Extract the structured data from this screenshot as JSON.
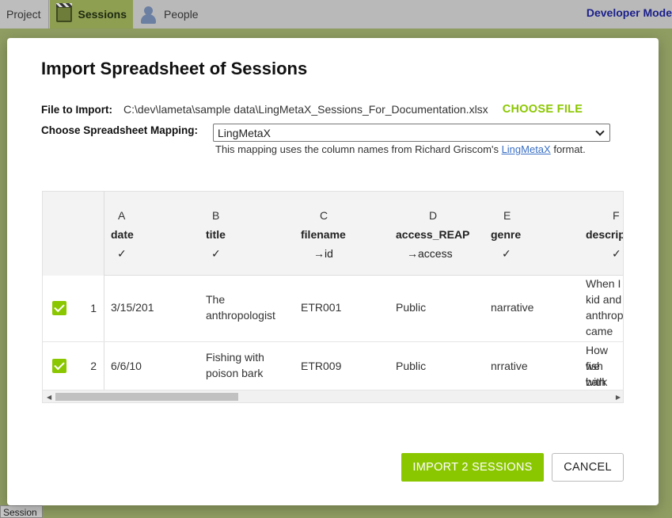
{
  "app": {
    "tabs": [
      {
        "label": "Project"
      },
      {
        "label": "Sessions"
      },
      {
        "label": "People"
      }
    ],
    "developer_mode": "Developer Mode",
    "bottom_tab": "Session"
  },
  "dialog": {
    "title": "Import Spreadsheet of Sessions",
    "file_label": "File to Import:",
    "file_path": "C:\\dev\\lameta\\sample data\\LingMetaX_Sessions_For_Documentation.xlsx",
    "choose_file_label": "CHOOSE FILE",
    "mapping_label": "Choose Spreadsheet Mapping:",
    "mapping_selected": "LingMetaX",
    "mapping_note_prefix": "This mapping uses the column names from Richard Griscom's ",
    "mapping_note_link": "LingMetaX",
    "mapping_note_suffix": " format.",
    "columns": [
      {
        "letter": "A",
        "name": "date",
        "mark": "✓"
      },
      {
        "letter": "B",
        "name": "title",
        "mark": "✓"
      },
      {
        "letter": "C",
        "name": "filename",
        "mark": "→id"
      },
      {
        "letter": "D",
        "name": "access_REAP",
        "mark": "→access"
      },
      {
        "letter": "E",
        "name": "genre",
        "mark": "✓"
      },
      {
        "letter": "F",
        "name": "description",
        "mark": "✓"
      }
    ],
    "rows": [
      {
        "checked": true,
        "num": "1",
        "date": "3/15/201",
        "title_l1": "The",
        "title_l2": "anthropologist",
        "filename": "ETR001",
        "access": "Public",
        "genre": "narrative",
        "desc_l1": "When I",
        "desc_l2": "kid and",
        "desc_l3": "anthrop",
        "desc_l4": "came"
      },
      {
        "checked": true,
        "num": "2",
        "date": "6/6/10",
        "title_l1": "Fishing with",
        "title_l2": "poison bark",
        "filename": "ETR009",
        "access": "Public",
        "genre": "nrrative",
        "desc_l1": "How we",
        "desc_l2": "fish with",
        "desc_l3": "bark"
      }
    ],
    "import_button": "IMPORT 2 SESSIONS",
    "cancel_button": "CANCEL"
  },
  "colors": {
    "accent": "#8bc700",
    "link": "#3a6fc4",
    "developer_mode": "#1a1f8a"
  }
}
